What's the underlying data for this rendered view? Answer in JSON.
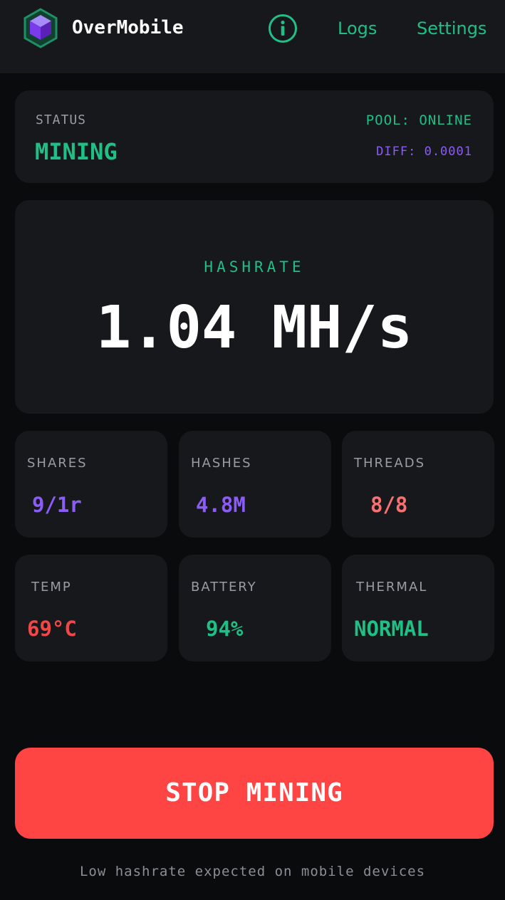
{
  "header": {
    "app_title": "OverMobile",
    "logo_icon": "hexagon-cube-icon",
    "info_icon": "info-circle-icon",
    "nav": {
      "logs_label": "Logs",
      "settings_label": "Settings"
    }
  },
  "status": {
    "label": "STATUS",
    "value": "MINING",
    "pool": "POOL: ONLINE",
    "diff": "DIFF: 0.0001"
  },
  "hashrate": {
    "label": "HASHRATE",
    "value": "1.04 MH/s"
  },
  "stats": [
    {
      "label": "SHARES",
      "value": "9/1r",
      "color": "#8b5cf6"
    },
    {
      "label": "HASHES",
      "value": "4.8M",
      "color": "#8b5cf6"
    },
    {
      "label": "THREADS",
      "value": "8/8",
      "color": "#f87171"
    },
    {
      "label": "TEMP",
      "value": "69°C",
      "color": "#f04848"
    },
    {
      "label": "BATTERY",
      "value": "94%",
      "color": "#1fbf86"
    },
    {
      "label": "THERMAL",
      "value": "NORMAL",
      "color": "#1fbf86"
    }
  ],
  "action": {
    "stop_label": "STOP MINING"
  },
  "footer": {
    "note": "Low hashrate expected on mobile devices"
  },
  "colors": {
    "accent_green": "#1fbf86",
    "accent_purple": "#8b5cf6",
    "danger_red": "#ff4444",
    "card_bg": "#17181c",
    "page_bg": "#0a0b0d"
  }
}
